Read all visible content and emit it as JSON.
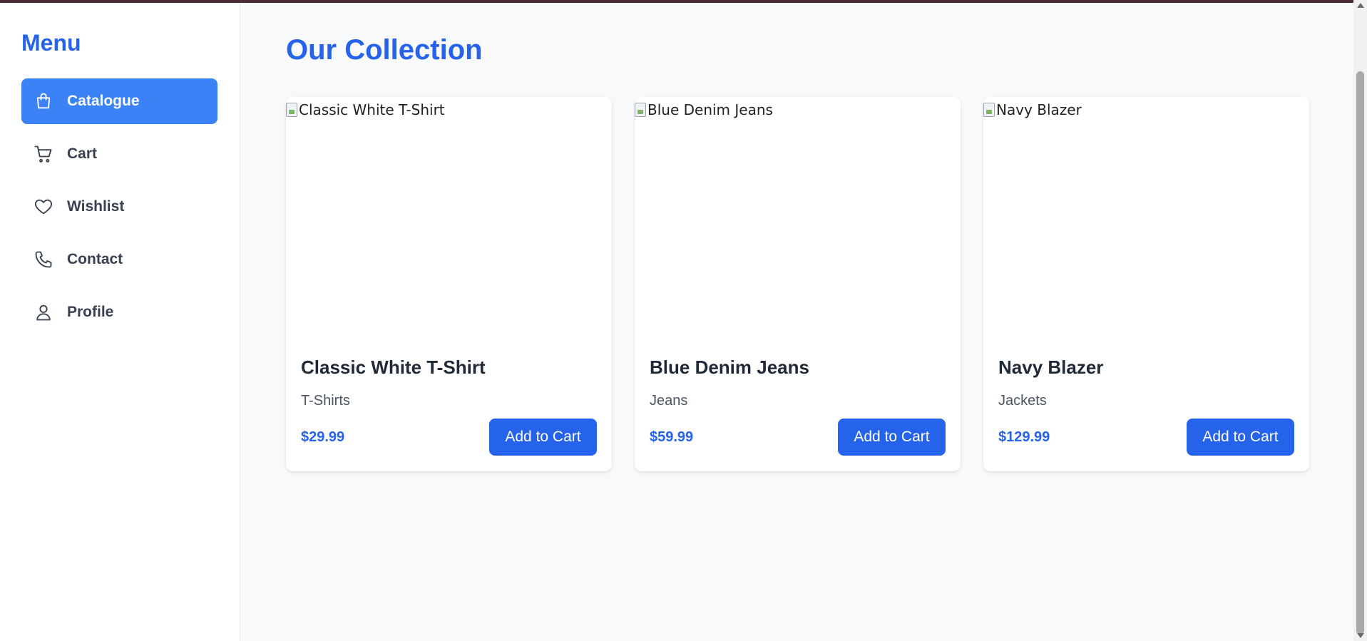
{
  "sidebar": {
    "title": "Menu",
    "items": [
      {
        "label": "Catalogue",
        "icon": "shopping-bag-icon",
        "active": true
      },
      {
        "label": "Cart",
        "icon": "cart-icon",
        "active": false
      },
      {
        "label": "Wishlist",
        "icon": "heart-icon",
        "active": false
      },
      {
        "label": "Contact",
        "icon": "phone-icon",
        "active": false
      },
      {
        "label": "Profile",
        "icon": "user-icon",
        "active": false
      }
    ]
  },
  "main": {
    "title": "Our Collection",
    "products": [
      {
        "image_alt": "Classic White T-Shirt",
        "name": "Classic White T-Shirt",
        "category": "T-Shirts",
        "price": "$29.99",
        "button_label": "Add to Cart"
      },
      {
        "image_alt": "Blue Denim Jeans",
        "name": "Blue Denim Jeans",
        "category": "Jeans",
        "price": "$59.99",
        "button_label": "Add to Cart"
      },
      {
        "image_alt": "Navy Blazer",
        "name": "Navy Blazer",
        "category": "Jackets",
        "price": "$129.99",
        "button_label": "Add to Cart"
      }
    ]
  },
  "colors": {
    "accent": "#2563eb",
    "active_nav": "#3b82f6",
    "background": "#f8f9fb"
  }
}
